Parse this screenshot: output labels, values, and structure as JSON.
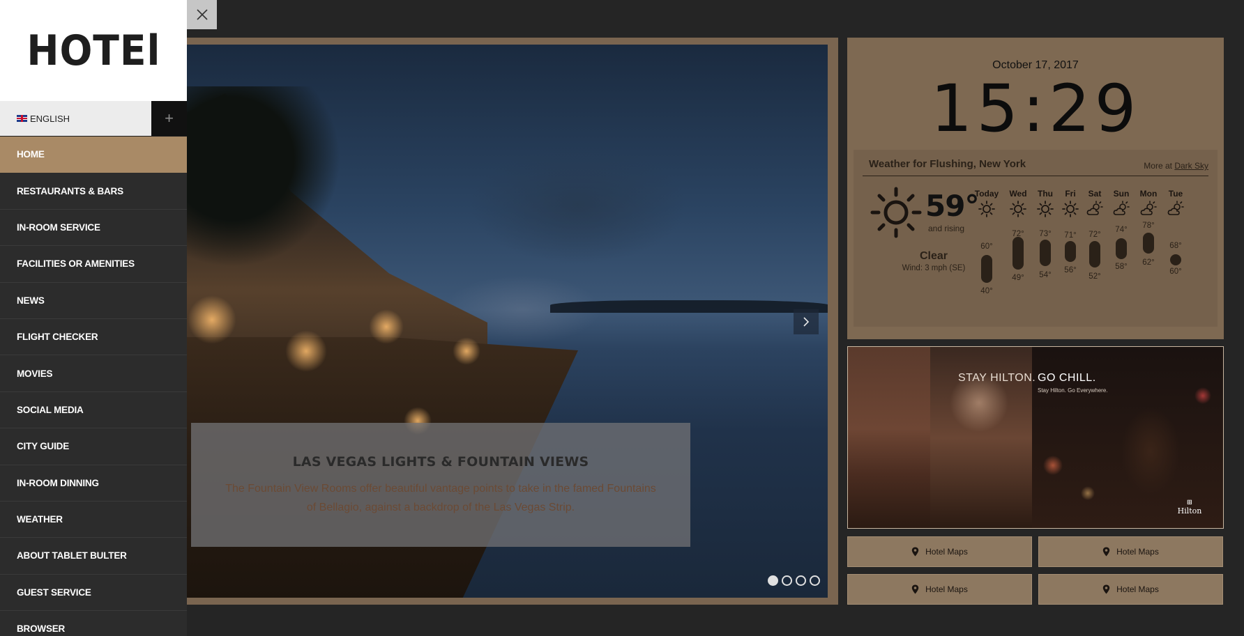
{
  "sidebar": {
    "logo": "HOTEl",
    "language": "ENGLISH",
    "add_icon": "plus-icon",
    "items": [
      {
        "label": "HOME",
        "active": true
      },
      {
        "label": "RESTAURANTS & BARS"
      },
      {
        "label": "IN-ROOM SERVICE"
      },
      {
        "label": "FACILITIES OR AMENITIES"
      },
      {
        "label": "NEWS"
      },
      {
        "label": "FLIGHT CHECKER"
      },
      {
        "label": "MOVIES"
      },
      {
        "label": "SOCIAL MEDIA"
      },
      {
        "label": "CITY GUIDE"
      },
      {
        "label": "IN-ROOM DINNING"
      },
      {
        "label": "WEATHER"
      },
      {
        "label": "ABOUT TABLET BULTER"
      },
      {
        "label": "GUEST SERVICE"
      },
      {
        "label": "BROWSER"
      }
    ]
  },
  "slider": {
    "caption_title": "LAS VEGAS LIGHTS & FOUNTAIN VIEWS",
    "caption_text": "The Fountain View Rooms offer beautiful vantage points to take in the famed Fountains of Bellagio, against a backdrop of the Las Vegas Strip.",
    "slide_count": 4,
    "active_slide": 1
  },
  "clock": {
    "date": "October 17, 2017",
    "time": "15:29"
  },
  "weather": {
    "title": "Weather for Flushing, New York",
    "more_prefix": "More at ",
    "more_link": "Dark Sky",
    "current_temp": "59°",
    "trend": "and rising",
    "condition": "Clear",
    "wind": "Wind: 3 mph (SE)",
    "forecast": [
      {
        "day": "Today",
        "hi": "60°",
        "lo": "40°",
        "icon": "sun-icon"
      },
      {
        "day": "Wed",
        "hi": "72°",
        "lo": "49°",
        "icon": "sun-icon"
      },
      {
        "day": "Thu",
        "hi": "73°",
        "lo": "54°",
        "icon": "sun-icon"
      },
      {
        "day": "Fri",
        "hi": "71°",
        "lo": "56°",
        "icon": "sun-icon"
      },
      {
        "day": "Sat",
        "hi": "72°",
        "lo": "52°",
        "icon": "partly-cloudy-icon"
      },
      {
        "day": "Sun",
        "hi": "74°",
        "lo": "58°",
        "icon": "partly-cloudy-icon"
      },
      {
        "day": "Mon",
        "hi": "78°",
        "lo": "62°",
        "icon": "partly-cloudy-icon"
      },
      {
        "day": "Tue",
        "hi": "68°",
        "lo": "60°",
        "icon": "partly-cloudy-icon"
      }
    ]
  },
  "ad": {
    "headline_left": "STAY HILTON.",
    "headline_right": "GO CHILL.",
    "subline": "Stay Hilton. Go Everywhere.",
    "brand": "Hilton"
  },
  "map_buttons": [
    {
      "label": "Hotel Maps"
    },
    {
      "label": "Hotel Maps"
    },
    {
      "label": "Hotel Maps"
    },
    {
      "label": "Hotel Maps"
    }
  ],
  "colors": {
    "accent": "#a98a66",
    "sidebar_bg": "#2c2c2c",
    "page_bg": "#252525"
  }
}
